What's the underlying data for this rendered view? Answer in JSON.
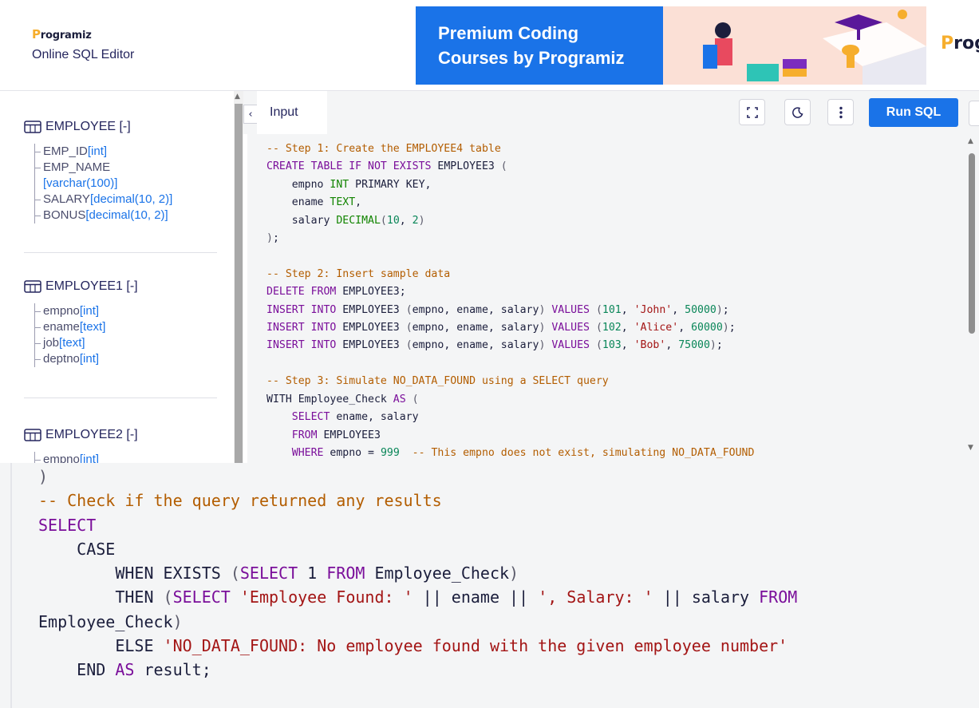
{
  "header": {
    "logo_text": "rogramiz",
    "logo_letter": "P",
    "subtitle": "Online SQL Editor",
    "banner_text_line1": "Premium Coding",
    "banner_text_line2": "Courses by Programiz",
    "banner_brand": "rogr",
    "banner_brand_letter": "P"
  },
  "sidebar": {
    "tables": [
      {
        "name": "EMPLOYEE [-]",
        "columns": [
          {
            "name": "EMP_ID",
            "type": "[int]"
          },
          {
            "name": "EMP_NAME",
            "type": "[varchar(100)]"
          },
          {
            "name": "SALARY",
            "type": "[decimal(10, 2)]"
          },
          {
            "name": "BONUS",
            "type": "[decimal(10, 2)]"
          }
        ]
      },
      {
        "name": "EMPLOYEE1 [-]",
        "columns": [
          {
            "name": "empno",
            "type": "[int]"
          },
          {
            "name": "ename",
            "type": "[text]"
          },
          {
            "name": "job",
            "type": "[text]"
          },
          {
            "name": "deptno",
            "type": "[int]"
          }
        ]
      },
      {
        "name": "EMPLOYEE2 [-]",
        "columns": [
          {
            "name": "empno",
            "type": "[int]"
          }
        ]
      }
    ]
  },
  "editor": {
    "collapse_icon": "chevron-left-icon",
    "tab_label": "Input",
    "run_label": "Run SQL",
    "tools": [
      "fullscreen-icon",
      "theme-moon-icon",
      "more-vertical-icon"
    ]
  },
  "code_lines": [
    "-- Step 1: Create the EMPLOYEE4 table",
    "CREATE TABLE IF NOT EXISTS EMPLOYEE3 (",
    "    empno INT PRIMARY KEY,",
    "    ename TEXT,",
    "    salary DECIMAL(10, 2)",
    ");",
    "",
    "-- Step 2: Insert sample data",
    "DELETE FROM EMPLOYEE3;",
    "INSERT INTO EMPLOYEE3 (empno, ename, salary) VALUES (101, 'John', 50000);",
    "INSERT INTO EMPLOYEE3 (empno, ename, salary) VALUES (102, 'Alice', 60000);",
    "INSERT INTO EMPLOYEE3 (empno, ename, salary) VALUES (103, 'Bob', 75000);",
    "",
    "-- Step 3: Simulate NO_DATA_FOUND using a SELECT query",
    "WITH Employee_Check AS (",
    "    SELECT ename, salary",
    "    FROM EMPLOYEE3",
    "    WHERE empno = 999  -- This empno does not exist, simulating NO_DATA_FOUND"
  ],
  "zoom_lines": [
    ")",
    "-- Check if the query returned any results",
    "SELECT",
    "    CASE",
    "        WHEN EXISTS (SELECT 1 FROM Employee_Check)",
    "        THEN (SELECT 'Employee Found: ' || ename || ', Salary: ' || salary FROM",
    "Employee_Check)",
    "        ELSE 'NO_DATA_FOUND: No employee found with the given employee number'",
    "    END AS result;"
  ],
  "colors": {
    "accent": "#1a73e8",
    "keyword": "#7a0e9a",
    "comment": "#b35d00",
    "string": "#a31515",
    "type": "#118400"
  }
}
